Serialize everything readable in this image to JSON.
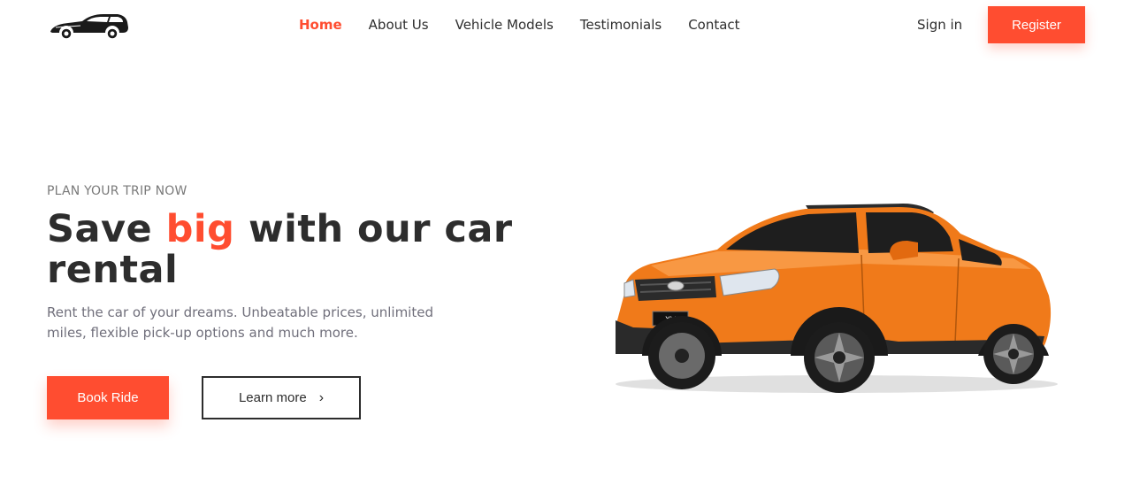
{
  "header": {
    "logo_icon": "sports-car-logo-icon",
    "nav": [
      "Home",
      "About Us",
      "Vehicle Models",
      "Testimonials",
      "Contact"
    ],
    "active_nav": "Home",
    "signin_label": "Sign in",
    "register_label": "Register"
  },
  "hero": {
    "eyebrow": "PLAN YOUR TRIP NOW",
    "headline_part1": "Save ",
    "headline_accent": "big",
    "headline_part2": " with our car rental",
    "subtext": "Rent the car of your dreams. Unbeatable prices, unlimited miles, flexible pick-up options and much more.",
    "book_label": "Book Ride",
    "learn_label": "Learn more",
    "learn_icon": "chevron-right-icon",
    "car_image": "orange-suv-image",
    "car_badge": "XV"
  },
  "colors": {
    "accent": "#ff4d30",
    "text": "#2d2d2d",
    "muted": "#706f7b",
    "car_body": "#f07a1a"
  }
}
